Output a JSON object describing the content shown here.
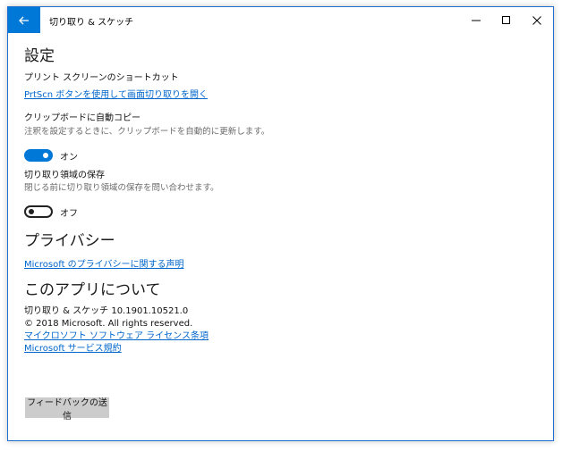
{
  "window": {
    "title": "切り取り & スケッチ",
    "back_icon": "arrow-left-icon",
    "controls": [
      "minimize-icon",
      "maximize-icon",
      "close-icon"
    ],
    "accent_color": "#0078d7"
  },
  "settings": {
    "heading": "設定",
    "print_screen": {
      "label": "プリント スクリーンのショートカット",
      "link": "PrtScn ボタンを使用して画面切り取りを開く"
    },
    "auto_copy": {
      "label": "クリップボードに自動コピー",
      "description": "注釈を設定するときに、クリップボードを自動的に更新します。",
      "state_label": "オン",
      "on": true
    },
    "save_snips": {
      "label": "切り取り領域の保存",
      "description": "閉じる前に切り取り領域の保存を問い合わせます。",
      "state_label": "オフ",
      "on": false
    }
  },
  "privacy": {
    "heading": "プライバシー",
    "link": "Microsoft のプライバシーに関する声明"
  },
  "about": {
    "heading": "このアプリについて",
    "version": "切り取り & スケッチ 10.1901.10521.0",
    "copyright": "© 2018 Microsoft. All rights reserved.",
    "license_link": "マイクロソフト ソフトウェア ライセンス条項",
    "terms_link": "Microsoft サービス規約"
  },
  "feedback_button": "フィードバックの送信"
}
